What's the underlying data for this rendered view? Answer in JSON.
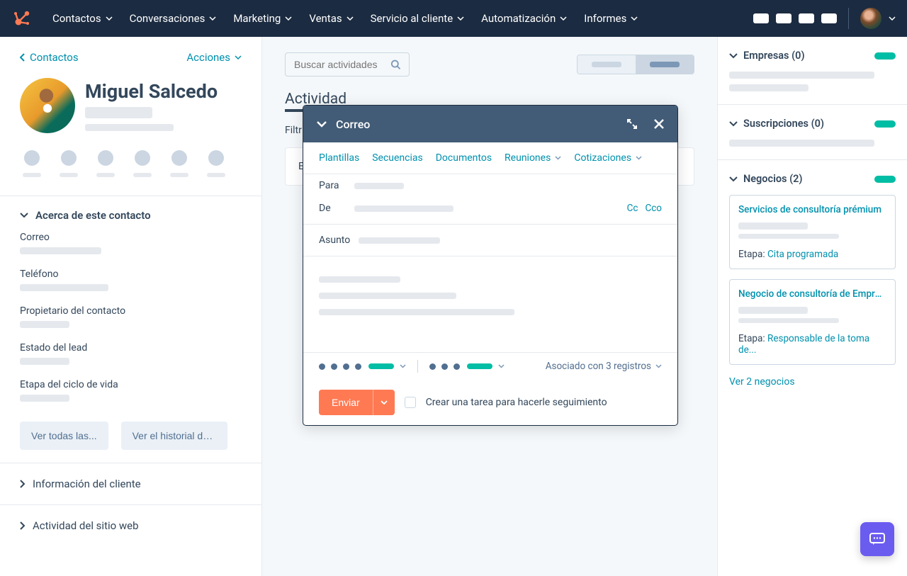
{
  "nav": {
    "items": [
      "Contactos",
      "Conversaciones",
      "Marketing",
      "Ventas",
      "Servicio al cliente",
      "Automatización",
      "Informes"
    ]
  },
  "left": {
    "back": "Contactos",
    "actions": "Acciones",
    "name": "Miguel Salcedo",
    "about_header": "Acerca de este contacto",
    "props": {
      "correo": "Correo",
      "telefono": "Teléfono",
      "propietario": "Propietario del contacto",
      "estado_lead": "Estado del lead",
      "etapa_ciclo": "Etapa del ciclo de vida"
    },
    "btn_ver_todas": "Ver todas las...",
    "btn_ver_historial": "Ver el historial de la...",
    "info_cliente": "Información del cliente",
    "actividad_sitio": "Actividad del sitio web"
  },
  "center": {
    "search_placeholder": "Buscar actividades",
    "actividad": "Actividad",
    "filtro": "Filtr",
    "es_label": "Es"
  },
  "modal": {
    "title": "Correo",
    "tabs": {
      "plantillas": "Plantillas",
      "secuencias": "Secuencias",
      "documentos": "Documentos",
      "reuniones": "Reuniones",
      "cotizaciones": "Cotizaciones"
    },
    "para": "Para",
    "de": "De",
    "cc": "Cc",
    "cco": "Cco",
    "asunto": "Asunto",
    "asociado": "Asociado con 3 registros",
    "enviar": "Enviar",
    "crear_tarea": "Crear una tarea para hacerle seguimiento"
  },
  "right": {
    "empresas": "Empresas (0)",
    "suscripciones": "Suscripciones (0)",
    "negocios": "Negocios (2)",
    "deal1": {
      "title": "Servicios de consultoría prémium",
      "etapa_label": "Etapa:",
      "etapa_value": "Cita programada"
    },
    "deal2": {
      "title": "Negocio de consultoría de Empres...",
      "etapa_label": "Etapa:",
      "etapa_value": "Responsable de la toma de..."
    },
    "ver_negocios": "Ver 2 negocios"
  }
}
